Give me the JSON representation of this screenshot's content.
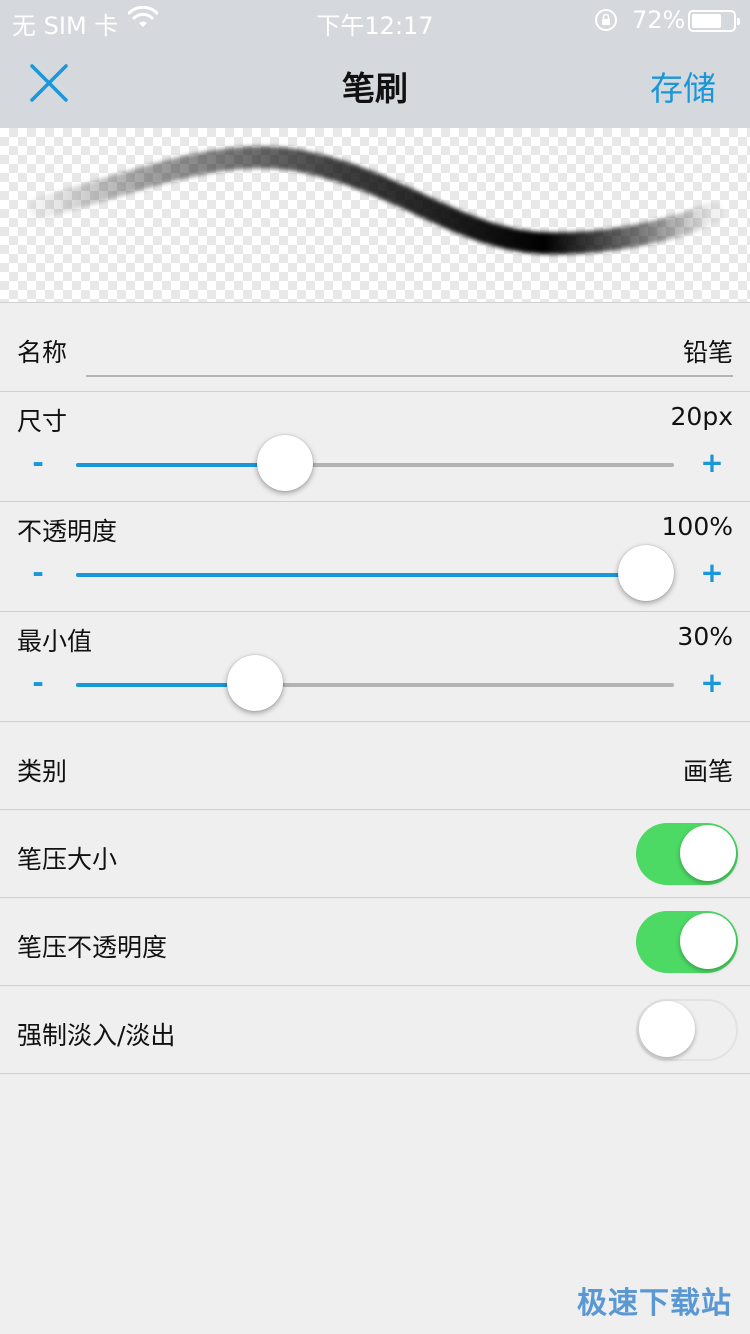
{
  "status_bar": {
    "carrier": "无 SIM 卡",
    "time": "下午12:17",
    "battery_percent": "72%",
    "battery_level": 0.72
  },
  "nav": {
    "title": "笔刷",
    "save_label": "存储",
    "close_icon": "close-icon"
  },
  "form": {
    "name": {
      "label": "名称",
      "value": "铅笔"
    },
    "size": {
      "label": "尺寸",
      "value": "20px",
      "minus": "-",
      "plus": "+",
      "level": 0.35
    },
    "opacity": {
      "label": "不透明度",
      "value": "100%",
      "minus": "-",
      "plus": "+",
      "level": 1.0
    },
    "min_value": {
      "label": "最小值",
      "value": "30%",
      "minus": "-",
      "plus": "+",
      "level": 0.3
    },
    "category": {
      "label": "类别",
      "value": "画笔"
    },
    "pressure_size": {
      "label": "笔压大小",
      "on": true
    },
    "pressure_opacity": {
      "label": "笔压不透明度",
      "on": true
    },
    "force_fade": {
      "label": "强制淡入/淡出",
      "on": false
    }
  },
  "colors": {
    "accent": "#1a97d9",
    "toggle_on": "#4cd964",
    "nav_bg": "#d5d9dd",
    "page_bg": "#efefef"
  },
  "watermark": "极速下载站"
}
